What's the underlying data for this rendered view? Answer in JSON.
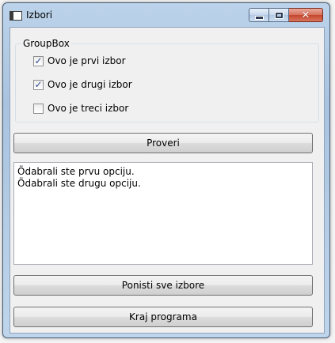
{
  "window": {
    "title": "Izbori"
  },
  "groupbox": {
    "title": "GroupBox",
    "options": [
      {
        "label": "Ovo je prvi izbor",
        "checked": true
      },
      {
        "label": "Ovo je drugi izbor",
        "checked": true
      },
      {
        "label": "Ovo je treci izbor",
        "checked": false
      }
    ]
  },
  "buttons": {
    "check_label": "Proveri",
    "reset_label": "Ponisti sve izbore",
    "exit_label": "Kraj programa"
  },
  "output": {
    "lines": [
      "Ödabrali ste prvu opciju.",
      "Ödabrali ste drugu opciju."
    ]
  },
  "icons": {
    "minimize": "minimize-icon",
    "maximize": "maximize-icon",
    "close": "close-icon"
  },
  "colors": {
    "titlebar": "#b6cde6",
    "close_button": "#c9472e",
    "client_bg": "#f0f0f0"
  }
}
